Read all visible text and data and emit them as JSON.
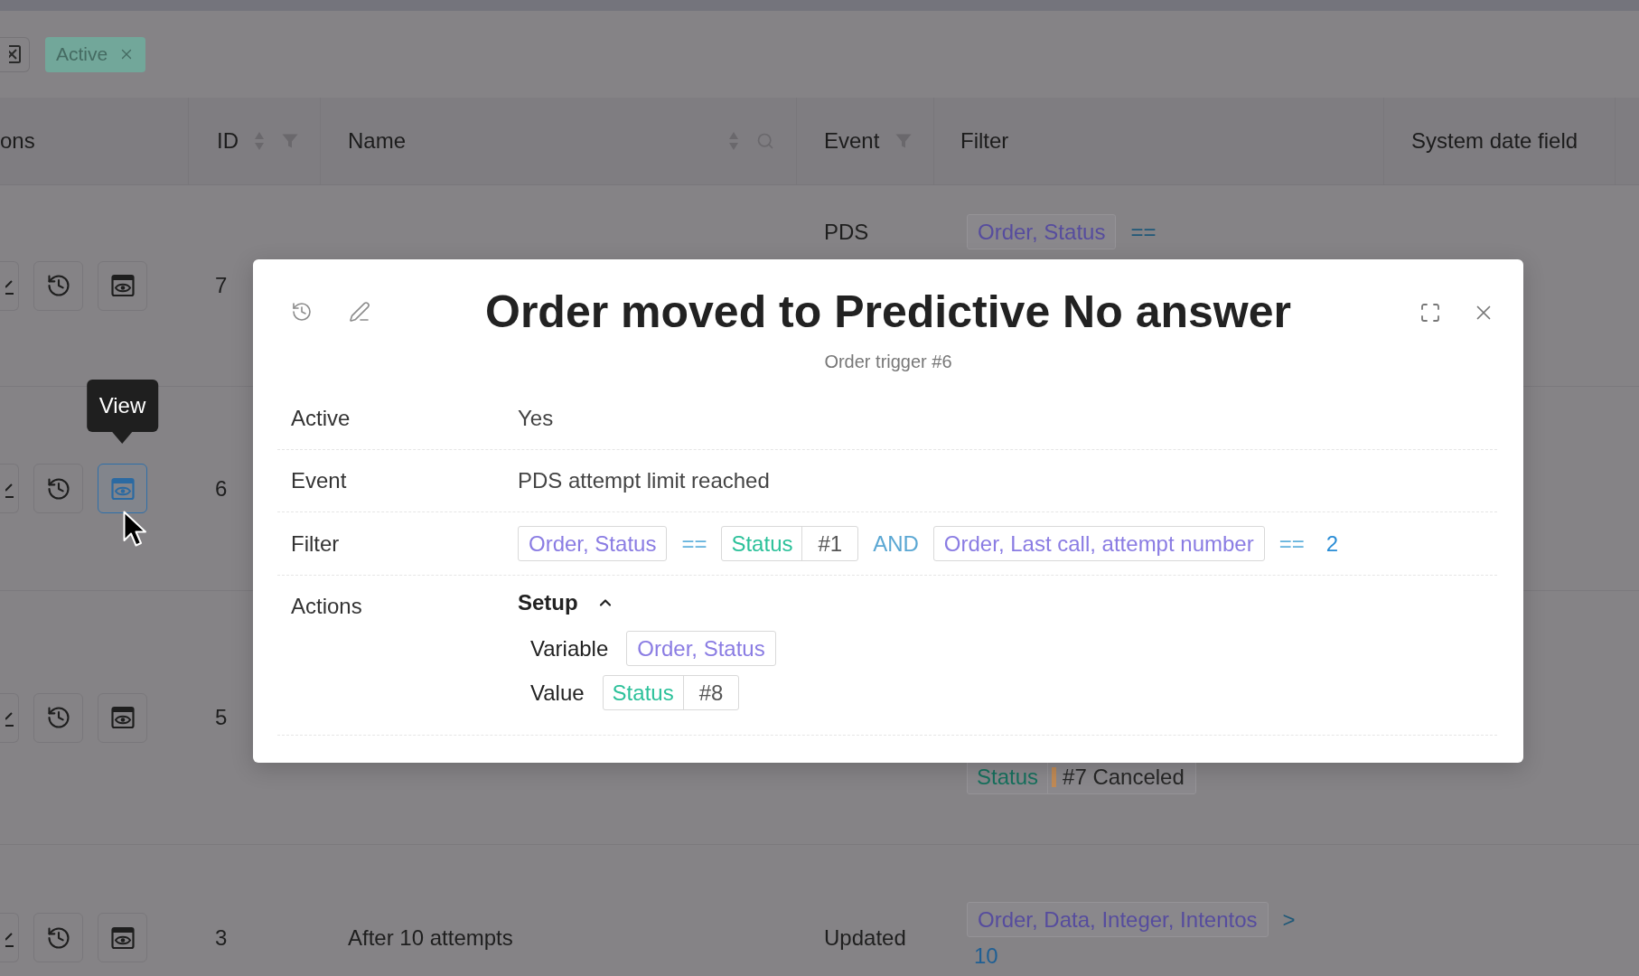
{
  "filter_bar": {
    "chips": [
      {
        "label": "Active"
      }
    ]
  },
  "table": {
    "columns": [
      {
        "label": "ons"
      },
      {
        "label": "ID",
        "icons": [
          {
            "kind": "sort"
          },
          {
            "kind": "funnel"
          }
        ]
      },
      {
        "label": "Name",
        "icons": [
          {
            "kind": "sort"
          },
          {
            "kind": "search"
          }
        ]
      },
      {
        "label": "Event",
        "icons": [
          {
            "kind": "funnel"
          }
        ]
      },
      {
        "label": "Filter"
      },
      {
        "label": "System date field"
      }
    ],
    "rows": [
      {
        "id": "7",
        "view_hovered": false,
        "event": "PDS",
        "filter": [
          {
            "kind": "field",
            "text": "Order, Status"
          },
          {
            "kind": "operator",
            "text": "=="
          }
        ]
      },
      {
        "id": "6",
        "view_hovered": true
      },
      {
        "id": "5",
        "view_hovered": false,
        "filter": [
          {
            "kind": "status",
            "label": "Status",
            "value": "#7 Canceled",
            "color": "#c08a55"
          }
        ]
      },
      {
        "id": "3",
        "view_hovered": false,
        "name": "After 10 attempts",
        "event": "Updated",
        "filter": [
          {
            "kind": "field",
            "text": "Order, Data, Integer, Intentos"
          },
          {
            "kind": "operator",
            "text": ">"
          },
          {
            "kind": "value",
            "text": "10"
          }
        ]
      }
    ]
  },
  "tooltip": {
    "text": "View"
  },
  "dialog": {
    "title": "Order moved to Predictive No answer",
    "subtitle": "Order trigger #6",
    "fields": [
      {
        "kind": "text",
        "label": "Active",
        "value": "Yes"
      },
      {
        "kind": "text",
        "label": "Event",
        "value": "PDS attempt limit reached"
      },
      {
        "kind": "filter",
        "label": "Filter",
        "tokens": [
          {
            "kind": "field",
            "text": "Order, Status"
          },
          {
            "kind": "operator",
            "text": "=="
          },
          {
            "kind": "status",
            "label": "Status",
            "value": "#1"
          },
          {
            "kind": "logic",
            "text": "AND"
          },
          {
            "kind": "field",
            "text": "Order, Last call, attempt number"
          },
          {
            "kind": "operator",
            "text": "=="
          },
          {
            "kind": "value",
            "text": "2"
          }
        ]
      },
      {
        "kind": "actions",
        "label": "Actions",
        "groups": [
          {
            "title": "Setup",
            "expanded": true,
            "items": [
              {
                "label": "Variable",
                "tokens": [
                  {
                    "kind": "field",
                    "text": "Order, Status"
                  }
                ]
              },
              {
                "label": "Value",
                "tokens": [
                  {
                    "kind": "status",
                    "label": "Status",
                    "value": "#8"
                  }
                ]
              }
            ]
          }
        ]
      }
    ]
  }
}
